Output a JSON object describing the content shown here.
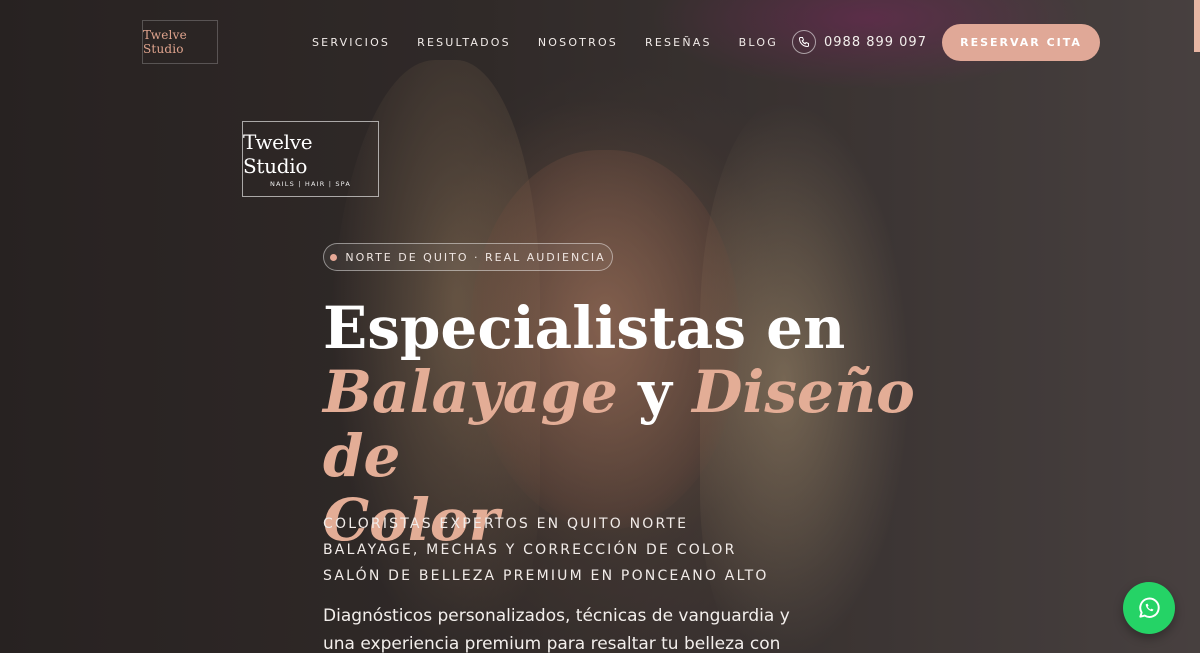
{
  "colors": {
    "accent": "#e0a897",
    "accent_text": "#e3ad96",
    "whatsapp": "#25d366"
  },
  "header": {
    "logo_text": "Twelve Studio",
    "nav": [
      "SERVICIOS",
      "RESULTADOS",
      "NOSOTROS",
      "RESEÑAS",
      "BLOG"
    ],
    "phone_icon": "phone-icon",
    "phone": "0988 899 097",
    "cta": "RESERVAR CITA"
  },
  "hero": {
    "logo_brand": "Twelve Studio",
    "logo_sub": "NAILS | HAIR | SPA",
    "badge": "NORTE DE QUITO · REAL AUDIENCIA",
    "headline": {
      "line1": "Especialistas en",
      "accent1": "Balayage",
      "connector": " y ",
      "accent2": "Diseño de",
      "accent3": "Color"
    },
    "taglines": [
      "COLORISTAS EXPERTOS EN QUITO NORTE",
      "BALAYAGE, MECHAS Y CORRECCIÓN DE COLOR",
      "SALÓN DE BELLEZA PREMIUM EN PONCEANO ALTO"
    ],
    "description": "Diagnósticos personalizados, técnicas de vanguardia y una experiencia premium para resaltar tu belleza con"
  },
  "floating": {
    "whatsapp_icon": "whatsapp-icon"
  }
}
